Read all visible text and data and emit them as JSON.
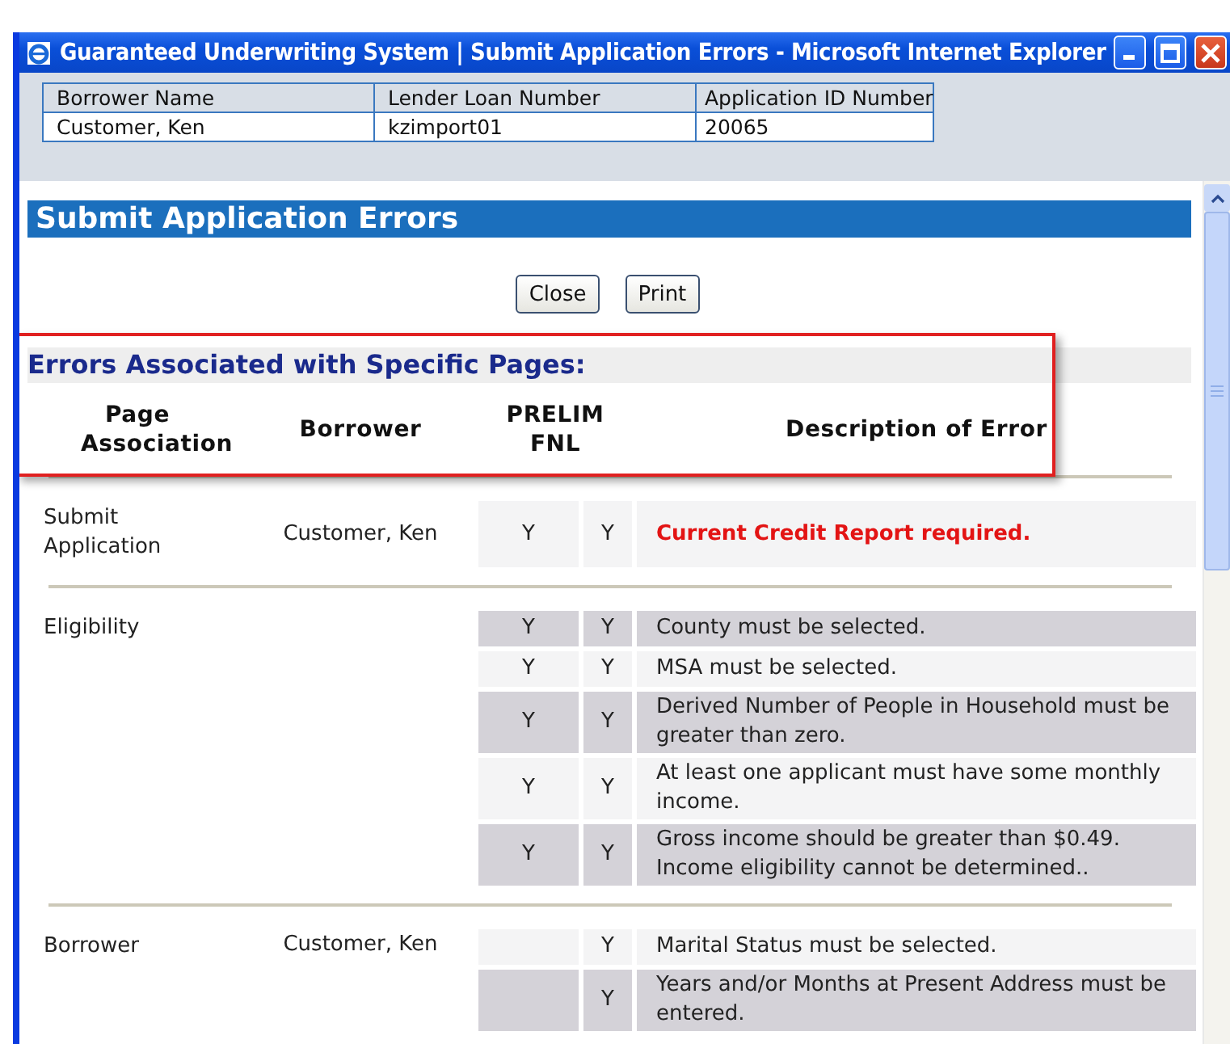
{
  "window": {
    "title": "Guaranteed Underwriting System | Submit Application Errors - Microsoft Internet Explorer"
  },
  "info_table": {
    "columns": [
      "Borrower Name",
      "Lender Loan Number",
      "Application ID Number"
    ],
    "row": [
      "Customer, Ken",
      "kzimport01",
      "20065"
    ]
  },
  "heading": "Submit Application Errors",
  "buttons": [
    "Close",
    "Print"
  ],
  "section_title": "Errors Associated with Specific Pages:",
  "columns": [
    "Page Association",
    "Borrower",
    "PRELIM FNL",
    "Description of Error"
  ],
  "groups": [
    {
      "page": "Submit Application",
      "borrower": "Customer, Ken",
      "items": [
        {
          "prelim": "Y",
          "fnl": "Y",
          "description": "Current Credit Report required.",
          "shaded": false,
          "highlight": true
        }
      ]
    },
    {
      "page": "Eligibility",
      "items": [
        {
          "prelim": "Y",
          "fnl": "Y",
          "description": "County must be selected.",
          "shaded": true,
          "highlight": false
        },
        {
          "prelim": "Y",
          "fnl": "Y",
          "description": "MSA must be selected.",
          "shaded": false,
          "highlight": false
        },
        {
          "prelim": "Y",
          "fnl": "Y",
          "description": "Derived Number of People in Household must be greater than zero.",
          "shaded": true,
          "highlight": false
        },
        {
          "prelim": "Y",
          "fnl": "Y",
          "description": "At least one applicant must have some monthly income.",
          "shaded": false,
          "highlight": false
        },
        {
          "prelim": "Y",
          "fnl": "Y",
          "description": "Gross income should be greater than $0.49. Income eligibility cannot be determined..",
          "shaded": true,
          "highlight": false
        }
      ]
    },
    {
      "page": "Borrower",
      "borrower": "Customer, Ken",
      "items": [
        {
          "fnl": "Y",
          "description": "Marital Status must be selected.",
          "shaded": false,
          "highlight": false
        },
        {
          "fnl": "Y",
          "description": "Years and/or Months at Present Address must be entered.",
          "shaded": true,
          "highlight": false
        }
      ]
    }
  ]
}
